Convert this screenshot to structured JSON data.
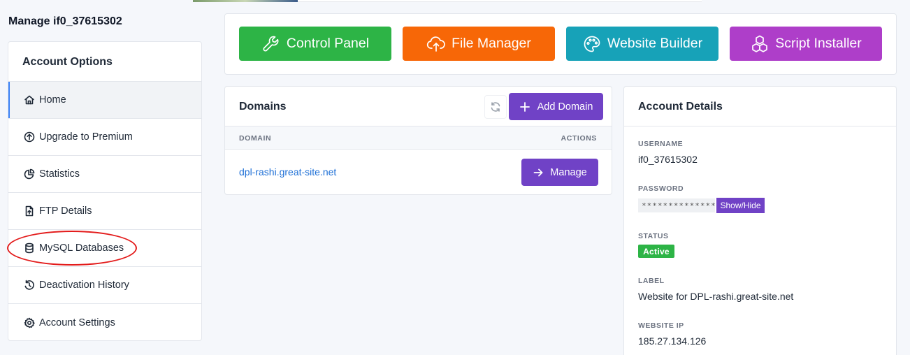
{
  "page": {
    "title": "Manage if0_37615302"
  },
  "sidebar": {
    "header": "Account Options",
    "items": [
      {
        "label": "Home",
        "icon": "home-icon",
        "active": true
      },
      {
        "label": "Upgrade to Premium",
        "icon": "arrow-up-circle-icon"
      },
      {
        "label": "Statistics",
        "icon": "pie-chart-icon"
      },
      {
        "label": "FTP Details",
        "icon": "file-upload-icon"
      },
      {
        "label": "MySQL Databases",
        "icon": "database-icon"
      },
      {
        "label": "Deactivation History",
        "icon": "history-icon"
      },
      {
        "label": "Account Settings",
        "icon": "gear-icon"
      }
    ]
  },
  "tools": {
    "control_panel": "Control Panel",
    "file_manager": "File Manager",
    "website_builder": "Website Builder",
    "script_installer": "Script Installer"
  },
  "domains": {
    "title": "Domains",
    "add_label": "Add Domain",
    "col_domain": "DOMAIN",
    "col_actions": "ACTIONS",
    "rows": [
      {
        "domain": "dpl-rashi.great-site.net",
        "action": "Manage"
      }
    ]
  },
  "account": {
    "title": "Account Details",
    "username_label": "USERNAME",
    "username": "if0_37615302",
    "password_label": "PASSWORD",
    "password_mask": "**************",
    "showhide": "Show/Hide",
    "status_label": "STATUS",
    "status": "Active",
    "label_label": "LABEL",
    "label": "Website for DPL-rashi.great-site.net",
    "ip_label": "WEBSITE IP",
    "ip": "185.27.134.126"
  },
  "colors": {
    "accent": "#7042c6",
    "green": "#2db446",
    "orange": "#f76707",
    "teal": "#17a2b8",
    "purple": "#ae3ec9",
    "annotation": "#e31b1b"
  }
}
